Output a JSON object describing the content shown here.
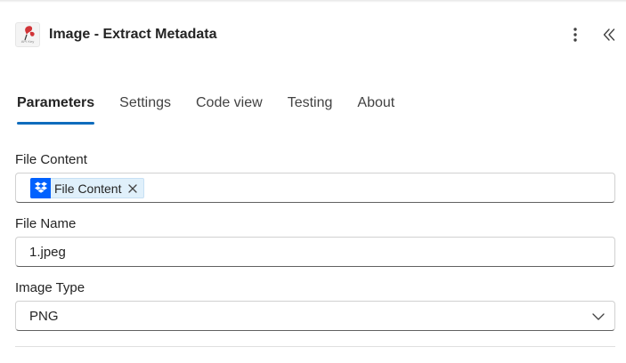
{
  "header": {
    "title": "Image - Extract Metadata",
    "app_icon": "api-key-logo-icon",
    "app_icon_caption": "API Key",
    "more_icon": "more-vertical-icon",
    "collapse_icon": "double-chevron-left-icon"
  },
  "tabs": [
    {
      "label": "Parameters",
      "active": true
    },
    {
      "label": "Settings",
      "active": false
    },
    {
      "label": "Code view",
      "active": false
    },
    {
      "label": "Testing",
      "active": false
    },
    {
      "label": "About",
      "active": false
    }
  ],
  "fields": {
    "file_content": {
      "label": "File Content",
      "token_label": "File Content",
      "token_icon": "dropbox-icon"
    },
    "file_name": {
      "label": "File Name",
      "value": "1.jpeg"
    },
    "image_type": {
      "label": "Image Type",
      "value": "PNG"
    }
  },
  "colors": {
    "accent": "#0f6cbd",
    "token_bg": "#e0f0fb",
    "dropbox": "#0061fe",
    "logo_red": "#d13438"
  }
}
